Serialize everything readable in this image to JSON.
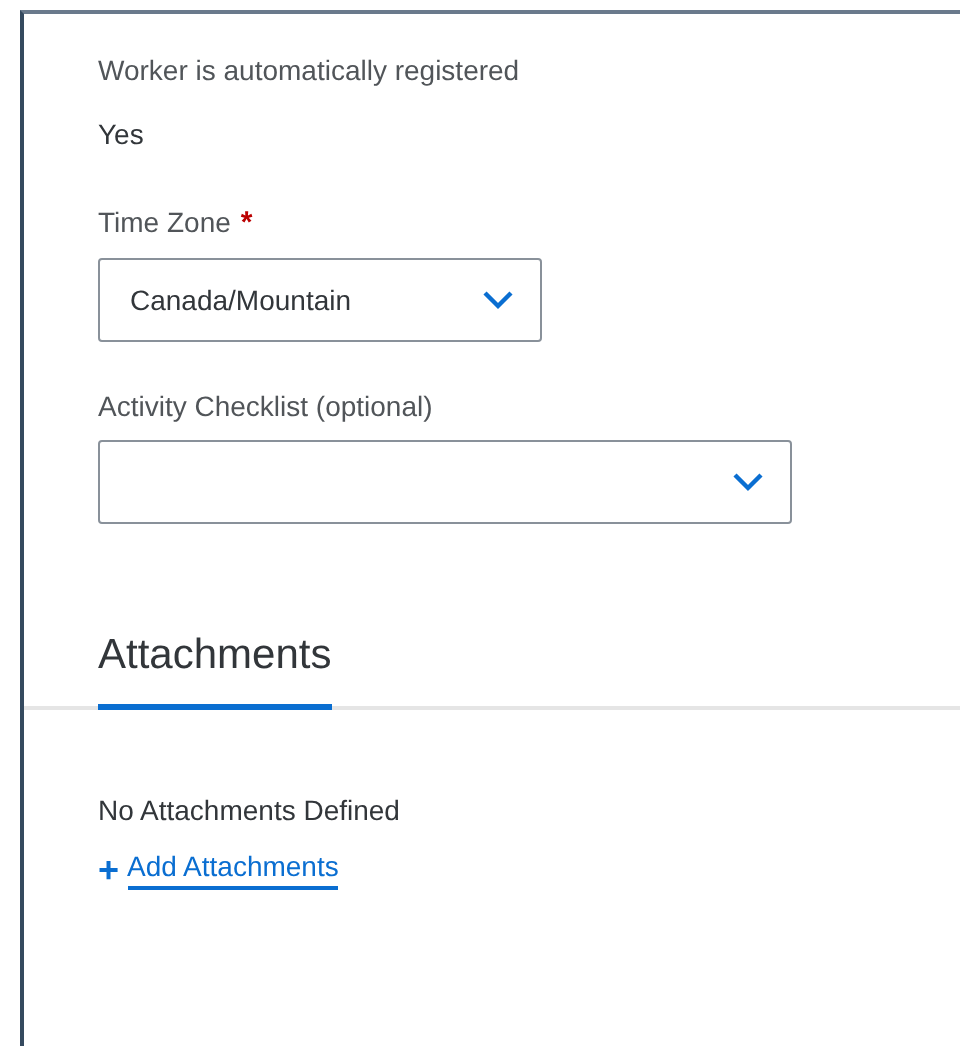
{
  "fields": [
    {
      "kind": "readonly",
      "label": "Worker is automatically registered",
      "value": "Yes"
    },
    {
      "kind": "select",
      "label": "Time Zone",
      "required_mark": "*",
      "value": "Canada/Mountain"
    },
    {
      "kind": "select",
      "label": "Activity Checklist (optional)"
    }
  ],
  "attachments": {
    "tabs": [
      {
        "label": "Attachments",
        "selected": true
      }
    ],
    "empty_text": "No Attachments Defined",
    "add_link": {
      "icon": "+",
      "label": "Add Attachments"
    }
  }
}
